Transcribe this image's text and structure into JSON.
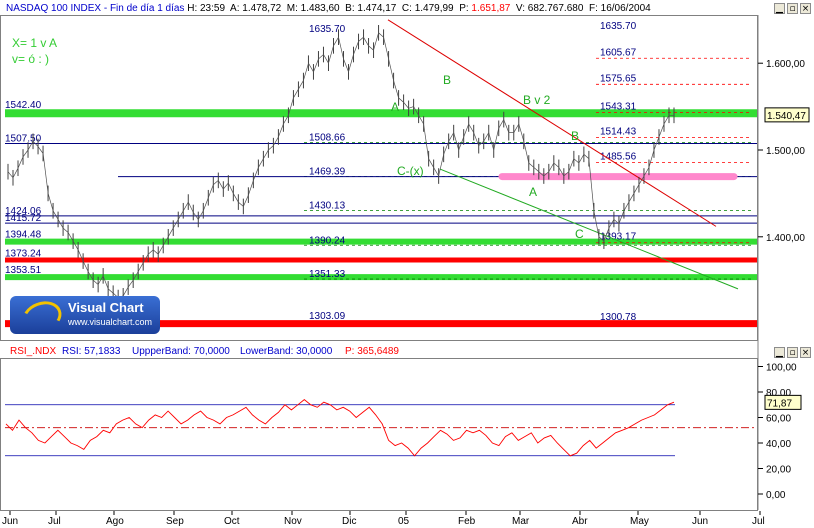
{
  "header": {
    "symbol": "NASDAQ 100 INDEX",
    "period": "Fin de día 1 días",
    "h_label": "H:",
    "h_value": "23:59",
    "a_label": "A:",
    "a_value": "1.478,72",
    "m_label": "M:",
    "m_value": "1.483,60",
    "b_label": "B:",
    "b_value": "1.474,17",
    "c_label": "C:",
    "c_value": "1.479,99",
    "p_label": "P:",
    "p_value": "1.651,87",
    "v_label": "V:",
    "v_value": "682.767.680",
    "f_label": "F:",
    "f_value": "16/06/2004"
  },
  "notes": {
    "line1": "X= 1 v A",
    "line2": "v= ó : )"
  },
  "logo": {
    "name": "Visual Chart",
    "url": "www.visualchart.com"
  },
  "colors": {
    "green": "#33dd33",
    "red": "#ff0000",
    "pink": "#ff88cc",
    "navy": "#000080",
    "grid": "#008000"
  },
  "chart_data": [
    {
      "type": "line",
      "title": "",
      "x": [
        "Jun",
        "Jul",
        "Ago",
        "Sep",
        "Oct",
        "Nov",
        "Dic",
        "05",
        "Feb",
        "Mar",
        "Abr",
        "May",
        "Jun",
        "Jul"
      ],
      "ylim": [
        1285,
        1665
      ],
      "y_ticks": [
        "1.600,00",
        "1.500,00",
        "1.400,00"
      ],
      "last_value": "1.540,47",
      "levels_left": [
        "1542.40",
        "1507.50",
        "1424.06",
        "1415.72",
        "1394.48",
        "1373.24",
        "1353.51"
      ],
      "levels_box": [
        "1635.70",
        "1508.66",
        "1469.39",
        "1430.13",
        "1390.24",
        "1351.33",
        "1303.09"
      ],
      "levels_right": [
        "1635.70",
        "1605.67",
        "1575.65",
        "1543.31",
        "1514.43",
        "1485.56",
        "1393.17",
        "1300.78"
      ],
      "wave_labels": [
        "A",
        "B",
        "B v 2",
        "B",
        "C-(x)",
        "A",
        "C"
      ],
      "series": [
        {
          "values": [
            1475,
            1468,
            1479,
            1492,
            1500,
            1510,
            1504,
            1496,
            1450,
            1430,
            1420,
            1410,
            1405,
            1395,
            1385,
            1372,
            1360,
            1350,
            1345,
            1355,
            1340,
            1335,
            1330,
            1332,
            1342,
            1350,
            1360,
            1370,
            1380,
            1385,
            1380,
            1390,
            1400,
            1410,
            1420,
            1430,
            1440,
            1428,
            1420,
            1430,
            1445,
            1460,
            1465,
            1455,
            1462,
            1450,
            1440,
            1435,
            1448,
            1465,
            1480,
            1490,
            1500,
            1505,
            1515,
            1530,
            1540,
            1560,
            1570,
            1580,
            1600,
            1590,
            1605,
            1610,
            1600,
            1620,
            1630,
            1605,
            1590,
            1610,
            1625,
            1630,
            1620,
            1615,
            1635,
            1630,
            1605,
            1580,
            1560,
            1555,
            1548,
            1550,
            1540,
            1530,
            1490,
            1480,
            1470,
            1495,
            1510,
            1520,
            1500,
            1515,
            1530,
            1520,
            1505,
            1510,
            1520,
            1500,
            1525,
            1535,
            1520,
            1520,
            1530,
            1510,
            1485,
            1480,
            1475,
            1470,
            1475,
            1485,
            1480,
            1470,
            1475,
            1490,
            1485,
            1495,
            1490,
            1430,
            1400,
            1395,
            1410,
            1420,
            1415,
            1430,
            1440,
            1450,
            1460,
            1470,
            1480,
            1500,
            1515,
            1530,
            1540,
            1540
          ]
        }
      ]
    },
    {
      "type": "line",
      "title": "RSI_.NDX",
      "legend": [
        "RSI: 57,1833",
        "UppperBand: 70,0000",
        "LowerBand: 30,0000",
        "P: 365,6489"
      ],
      "ylim": [
        -10,
        105
      ],
      "y_ticks": [
        "100,00",
        "80,00",
        "60,00",
        "40,00",
        "20,00",
        "0,00"
      ],
      "last_value": "71,87",
      "upper_band": 70,
      "lower_band": 30,
      "mid_line": 52,
      "series": [
        {
          "name": "RSI",
          "values": [
            55,
            50,
            58,
            52,
            48,
            42,
            40,
            45,
            50,
            45,
            40,
            38,
            35,
            42,
            45,
            50,
            48,
            55,
            58,
            60,
            55,
            52,
            58,
            62,
            60,
            65,
            60,
            55,
            58,
            62,
            65,
            60,
            58,
            55,
            60,
            62,
            65,
            68,
            62,
            58,
            55,
            60,
            64,
            70,
            66,
            70,
            74,
            70,
            68,
            72,
            70,
            66,
            68,
            65,
            60,
            64,
            68,
            62,
            55,
            42,
            38,
            40,
            36,
            30,
            36,
            40,
            45,
            50,
            47,
            42,
            44,
            50,
            48,
            50,
            46,
            40,
            38,
            45,
            48,
            42,
            45,
            48,
            40,
            44,
            46,
            40,
            35,
            30,
            32,
            38,
            42,
            36,
            40,
            44,
            48,
            50,
            52,
            55,
            58,
            60,
            62,
            66,
            70,
            72
          ]
        }
      ]
    }
  ]
}
